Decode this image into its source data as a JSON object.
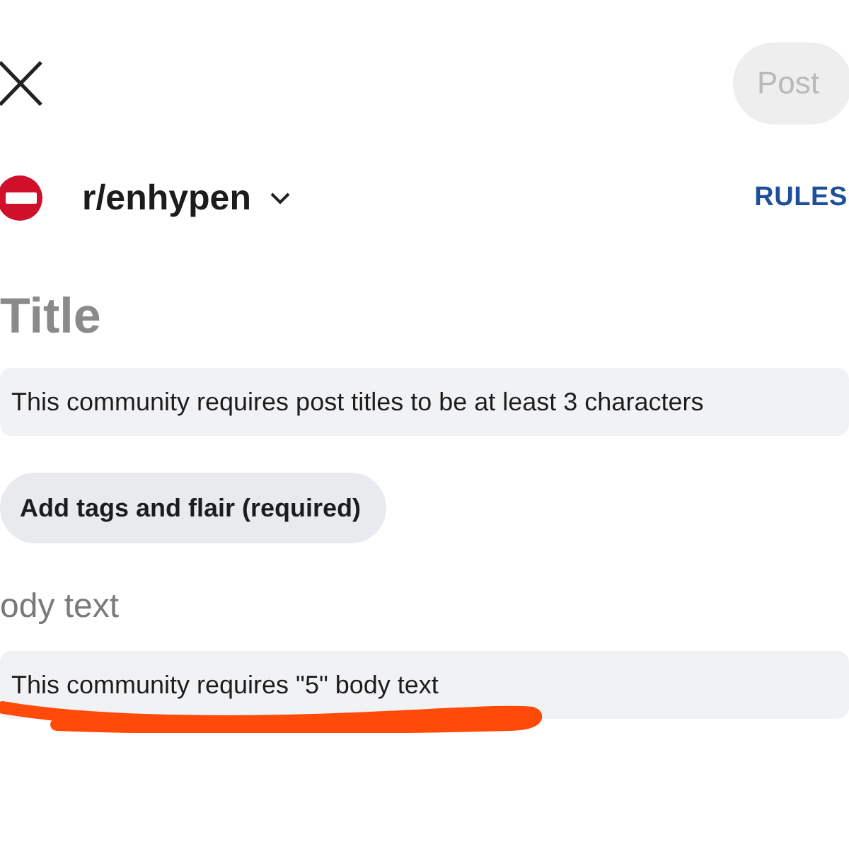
{
  "header": {
    "post_button": {
      "label": "Post",
      "disabled": true
    }
  },
  "community": {
    "name": "r/enhypen",
    "rules_link": "RULES"
  },
  "title_field": {
    "placeholder": "Title"
  },
  "title_notice": "This community requires post titles to be at least 3 characters",
  "tags_button": {
    "label": "Add tags and flair (required)"
  },
  "body_field": {
    "placeholder": "ody text"
  },
  "body_notice": "This community requires \"5\" body text"
}
